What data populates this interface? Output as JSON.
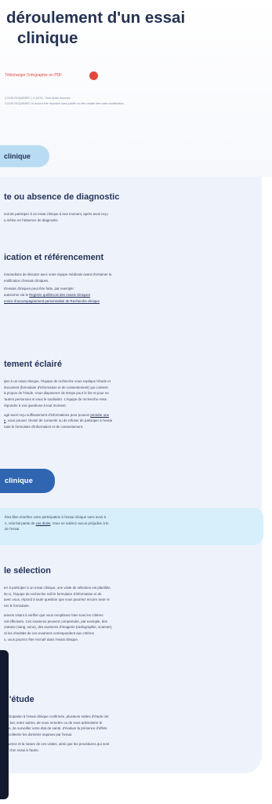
{
  "header": {
    "title_line1": "déroulement d'un essai",
    "title_line2": "clinique",
    "pdf_link": "Télécharger l'infographie en PDF",
    "meta_line1": "CCDIS-ROQUEBEC | V 3/07A · Tous droits réservés",
    "meta_line2": "CCDIS-ROQUEBEC et accord être reproduit sans justifié ou bien réalisé bien sans modification"
  },
  "pills": {
    "light": "clinique",
    "dark": "clinique"
  },
  "sections": {
    "s1": {
      "heading": "te ou absence de diagnostic",
      "line1": "soit de participer à un essai clinique à tout moment, après avoir reçu",
      "line2": "u même en l'absence de diagnostic."
    },
    "s2": {
      "heading": "ication et référencement",
      "line1": "mmandions de discuter avec votre équipe médicale avant d'entamer la",
      "line2": "entification d'essais cliniques.",
      "line3": "d'essais cliniques peut être faite, par exemple :",
      "line4_prefix": "autonome via le ",
      "line4_link": "Registre québécois des essais cliniques",
      "line5_link": "ervice d'accompagnement personnalisé de Recherche clinique"
    },
    "s3": {
      "heading": "tement éclairé",
      "line1": "iper à un essai clinique, l'équipe de recherche vous explique l'étude et",
      "line2": "document (formulaire d'information et de consentement) qui contient",
      "line3": "à propos de l'étude. Vous disposerez de temps pour le lire et pour en",
      "line4": "'autres personnes si vous le souhaitez. L'équipe de recherche reste",
      "line5": "répondre à vos questions à tout moment.",
      "line6_prefix": "ugé avoir reçu suffisamment d'informations pour pouvoir ",
      "line6_link": "prendre une",
      "line7_link": "e",
      "line7_rest": ", vous pouvez choisir de consentir ou de refuser de participer à l'essai",
      "line8": "nant le formulaire d'information et de consentement."
    },
    "notice": {
      "line1": "êtes libre d'arrêter votre participation à l'essai clinique sans avoir à",
      "line2_prefix": "n, cela fait partie de ",
      "line2_link": "vos droits",
      "line2_rest": ". Vous ne subirez aucun préjudice à le",
      "line3": "de l'essai."
    },
    "s4": {
      "heading": "le sélection",
      "line1": "ter à participer à un essai clinique, une visite de sélection est planifiée.",
      "line2": "ite-ci, l'équipe de recherche relit le formulaire d'information et de",
      "line3": "avec vous, répond à toute question que vous pourriez encore avoir et",
      "line4": "ner le formulaire.",
      "line5": "amens visant à vérifier que vous remplissez bien tous les critères",
      "line6": "ont effectués. Ces examens peuvent comprendre, par exemple, des",
      "line7": "oratoire (sang, urine), des examens d'imagerie (radiographie, scanner),",
      "line8": "Si les résultats de ces examens correspondent aux critères",
      "line9": "s, vous pourrez être recruté dans l'essai clinique."
    },
    "s5": {
      "heading": "d'étude",
      "line1": "participation à l'essai clinique confirmée, plusieurs visites d'étude ont",
      "line2": "our but, entre autres, de vous remettre ou de vous administrer le",
      "line3": "tude, de surveiller votre état de santé, d'évaluer la présence d'effets",
      "line4": "de collecter les données requises par l'essai.",
      "line5": "équence et la nature de ces visites, ainsi que les procédures qui sont",
      "line6": "ent d'un essai à l'autre."
    }
  },
  "colors": {
    "title": "#253352",
    "accent_red": "#e2473d",
    "pill_light": "#b9dcf3",
    "pill_dark": "#2f65b1",
    "card_bg": "#eef3fb",
    "notice_bg": "#d7effa",
    "edge_bar": "#13192e"
  }
}
